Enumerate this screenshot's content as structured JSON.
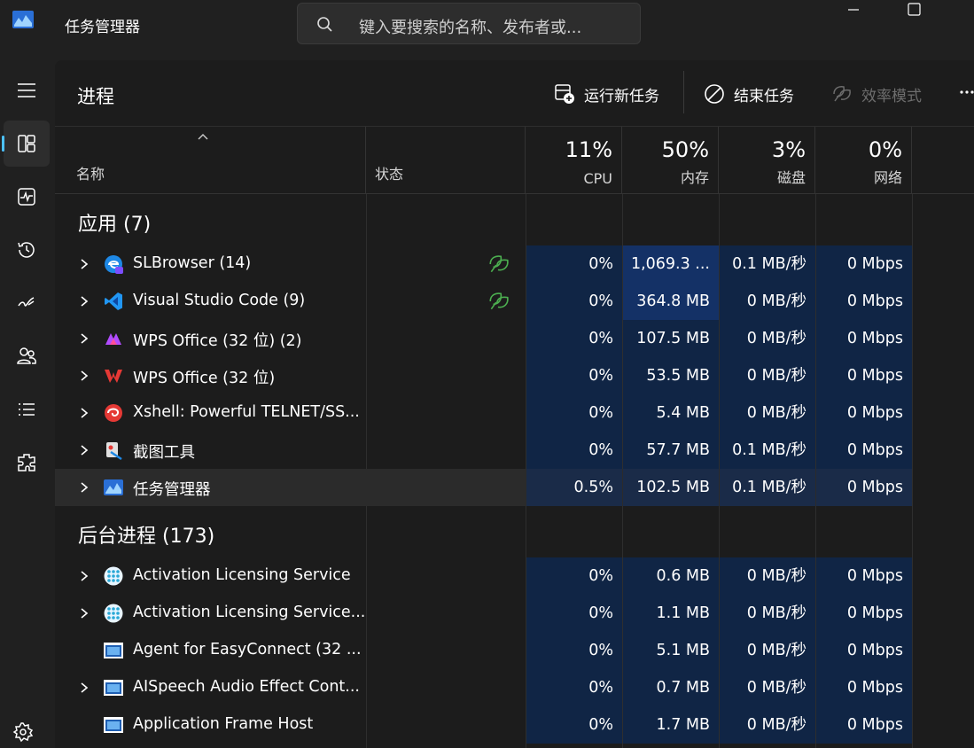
{
  "app": {
    "title": "任务管理器"
  },
  "search": {
    "placeholder": "键入要搜索的名称、发布者或..."
  },
  "page": {
    "title": "进程"
  },
  "toolbar": {
    "run_new_task": "运行新任务",
    "end_task": "结束任务",
    "efficiency_mode": "效率模式"
  },
  "nav": {
    "items": [
      "menu-icon",
      "processes-icon",
      "performance-icon",
      "app-history-icon",
      "startup-icon",
      "users-icon",
      "details-icon",
      "services-icon",
      "settings-icon"
    ],
    "active": "processes"
  },
  "columns": {
    "name": "名称",
    "status": "状态",
    "cpu": {
      "pct": "11%",
      "label": "CPU"
    },
    "mem": {
      "pct": "50%",
      "label": "内存"
    },
    "disk": {
      "pct": "3%",
      "label": "磁盘"
    },
    "net": {
      "pct": "0%",
      "label": "网络"
    }
  },
  "groups": {
    "apps": "应用 (7)",
    "background": "后台进程 (173)"
  },
  "apps": [
    {
      "name": "SLBrowser (14)",
      "icon": "slbrowser-icon",
      "efficiency": true,
      "cpu": "0%",
      "mem": "1,069.3 ...",
      "disk": "0.1 MB/秒",
      "net": "0 Mbps",
      "expandable": true
    },
    {
      "name": "Visual Studio Code (9)",
      "icon": "vscode-icon",
      "efficiency": true,
      "cpu": "0%",
      "mem": "364.8 MB",
      "disk": "0 MB/秒",
      "net": "0 Mbps",
      "expandable": true
    },
    {
      "name": "WPS Office (32 位) (2)",
      "icon": "wps-ai-icon",
      "efficiency": false,
      "cpu": "0%",
      "mem": "107.5 MB",
      "disk": "0 MB/秒",
      "net": "0 Mbps",
      "expandable": true
    },
    {
      "name": "WPS Office (32 位)",
      "icon": "wps-icon",
      "efficiency": false,
      "cpu": "0%",
      "mem": "53.5 MB",
      "disk": "0 MB/秒",
      "net": "0 Mbps",
      "expandable": true
    },
    {
      "name": "Xshell: Powerful TELNET/SS...",
      "icon": "xshell-icon",
      "efficiency": false,
      "cpu": "0%",
      "mem": "5.4 MB",
      "disk": "0 MB/秒",
      "net": "0 Mbps",
      "expandable": true
    },
    {
      "name": "截图工具",
      "icon": "snipping-tool-icon",
      "efficiency": false,
      "cpu": "0%",
      "mem": "57.7 MB",
      "disk": "0.1 MB/秒",
      "net": "0 Mbps",
      "expandable": true
    },
    {
      "name": "任务管理器",
      "icon": "task-manager-icon",
      "efficiency": false,
      "cpu": "0.5%",
      "mem": "102.5 MB",
      "disk": "0.1 MB/秒",
      "net": "0 Mbps",
      "expandable": true
    }
  ],
  "background": [
    {
      "name": "Activation Licensing Service",
      "icon": "service-icon",
      "cpu": "0%",
      "mem": "0.6 MB",
      "disk": "0 MB/秒",
      "net": "0 Mbps",
      "expandable": true
    },
    {
      "name": "Activation Licensing Service...",
      "icon": "service-icon",
      "cpu": "0%",
      "mem": "1.1 MB",
      "disk": "0 MB/秒",
      "net": "0 Mbps",
      "expandable": true
    },
    {
      "name": "Agent for EasyConnect (32 ...",
      "icon": "window-app-icon",
      "cpu": "0%",
      "mem": "5.1 MB",
      "disk": "0 MB/秒",
      "net": "0 Mbps",
      "expandable": false
    },
    {
      "name": "AISpeech Audio Effect Cont...",
      "icon": "window-app-icon",
      "cpu": "0%",
      "mem": "0.7 MB",
      "disk": "0 MB/秒",
      "net": "0 Mbps",
      "expandable": true
    },
    {
      "name": "Application Frame Host",
      "icon": "window-app-icon",
      "cpu": "0%",
      "mem": "1.7 MB",
      "disk": "0 MB/秒",
      "net": "0 Mbps",
      "expandable": false
    }
  ]
}
